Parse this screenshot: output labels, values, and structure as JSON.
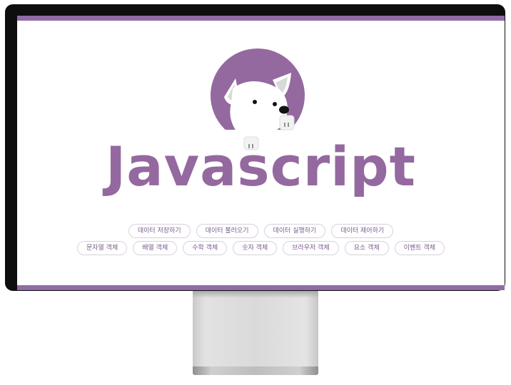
{
  "title": "Javascript",
  "tags_row1": [
    "데이터 저장하기",
    "데이터 불러오기",
    "데이터 실행하기",
    "데이터 제어하기"
  ],
  "tags_row2": [
    "문자열 객체",
    "배열 객체",
    "수학 객체",
    "숫자 객체",
    "브라우저 객체",
    "요소 객체",
    "이벤트 객체"
  ],
  "colors": {
    "accent": "#8f6ca6",
    "title": "#94699f",
    "bezel": "#0e0e0e"
  },
  "icons": [
    "dog-mascot-icon"
  ]
}
